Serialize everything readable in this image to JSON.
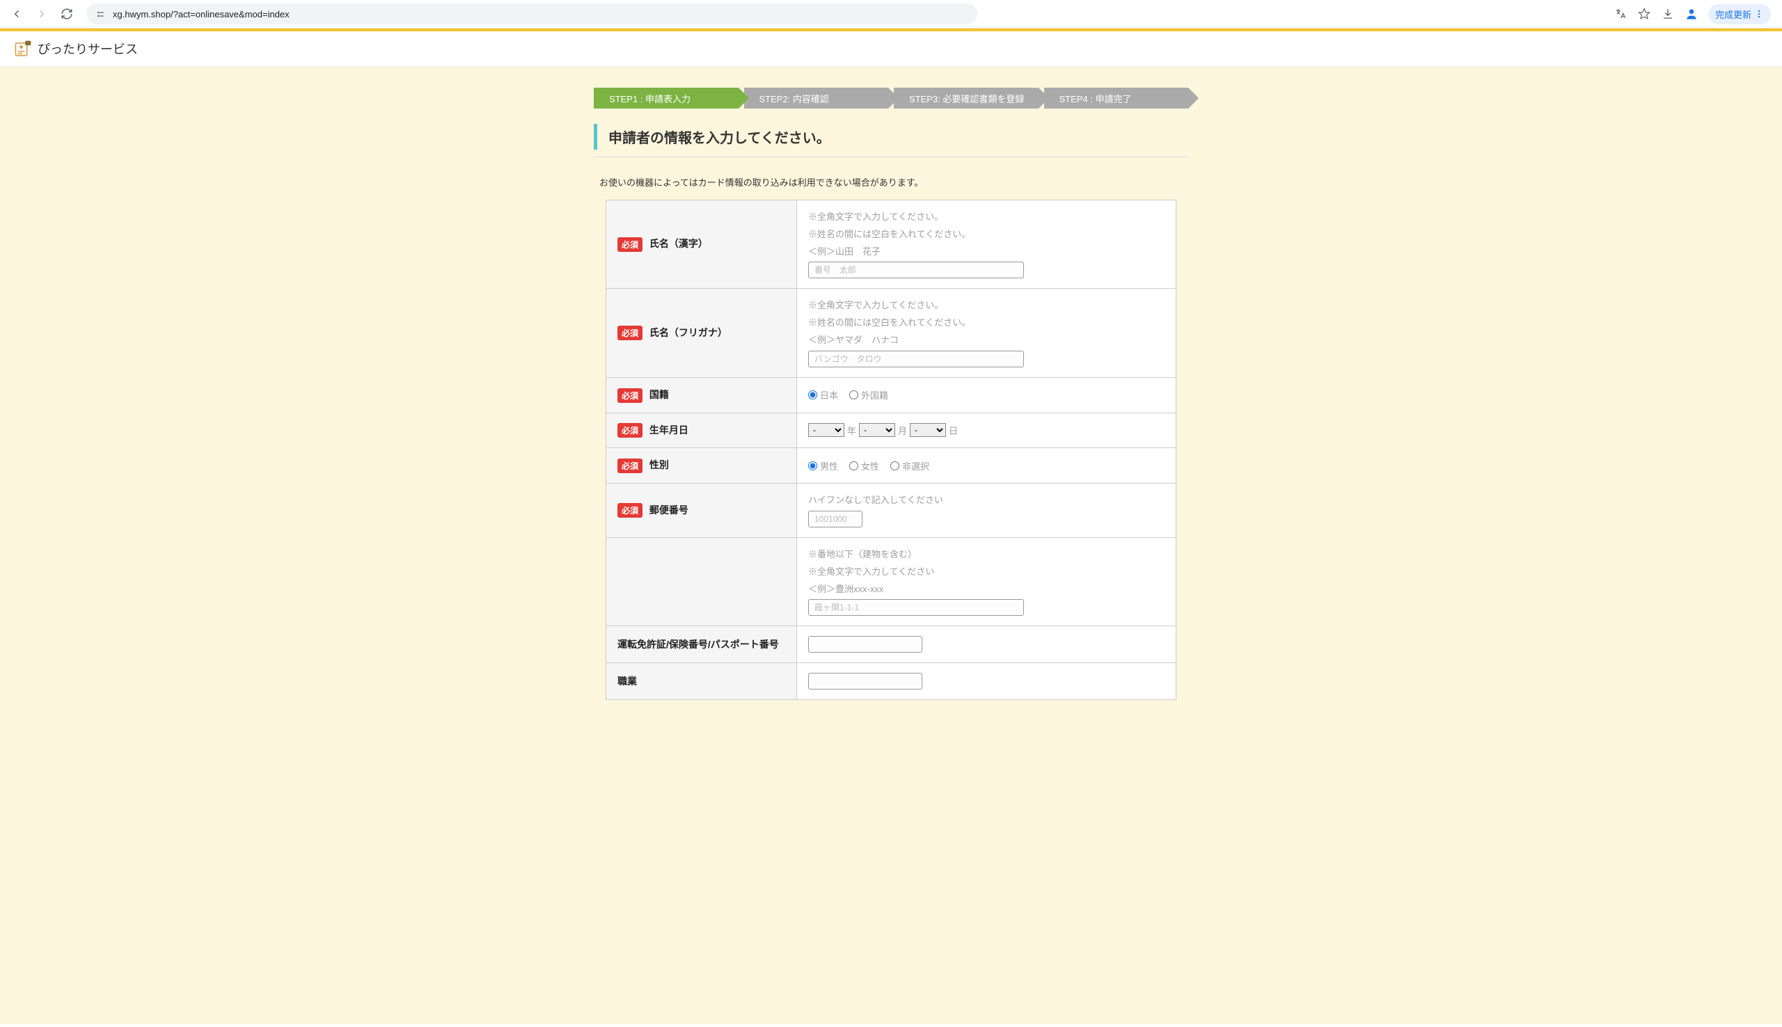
{
  "browser": {
    "url": "xg.hwym.shop/?act=onlinesave&mod=index",
    "install_label": "完成更新"
  },
  "site": {
    "title": "ぴったりサービス"
  },
  "steps": [
    {
      "label": "STEP1 : 申請表入力"
    },
    {
      "label": "STEP2:  内容確認"
    },
    {
      "label": "STEP3:  必要確認書類を登録"
    },
    {
      "label": "STEP4 : 申請完了"
    }
  ],
  "heading": "申請者の情報を入力してください。",
  "notice": "お使いの機器によってはカード情報の取り込みは利用できない場合があります。",
  "badge_required": "必須",
  "form": {
    "name_kanji": {
      "label": "氏名（漢字）",
      "hint1": "※全角文字で入力してください。",
      "hint2": "※姓名の間には空白を入れてください。",
      "hint3": "＜例＞山田　花子",
      "placeholder": "番号　太郎"
    },
    "name_kana": {
      "label": "氏名（フリガナ）",
      "hint1": "※全角文字で入力してください。",
      "hint2": "※姓名の間には空白を入れてください。",
      "hint3": "＜例＞ヤマダ　ハナコ",
      "placeholder": "バンゴウ　タロウ"
    },
    "nationality": {
      "label": "国籍",
      "opt1": "日本",
      "opt2": "外国籍"
    },
    "birthdate": {
      "label": "生年月日",
      "year_suffix": "年",
      "month_suffix": "月",
      "day_suffix": "日",
      "placeholder": "-"
    },
    "gender": {
      "label": "性別",
      "opt1": "男性",
      "opt2": "女性",
      "opt3": "非選択"
    },
    "postal": {
      "label": "郵便番号",
      "hint": "ハイフンなしで記入してください",
      "placeholder": "1001000"
    },
    "address": {
      "hint1": "※番地以下（建物を含む）",
      "hint2": "※全角文字で入力してください",
      "hint3": "＜例＞豊洲xxx-xxx",
      "placeholder": "霞ヶ関1-1-1"
    },
    "license": {
      "label": "運転免許証/保険番号/パスポート番号"
    },
    "occupation": {
      "label": "職業"
    }
  }
}
